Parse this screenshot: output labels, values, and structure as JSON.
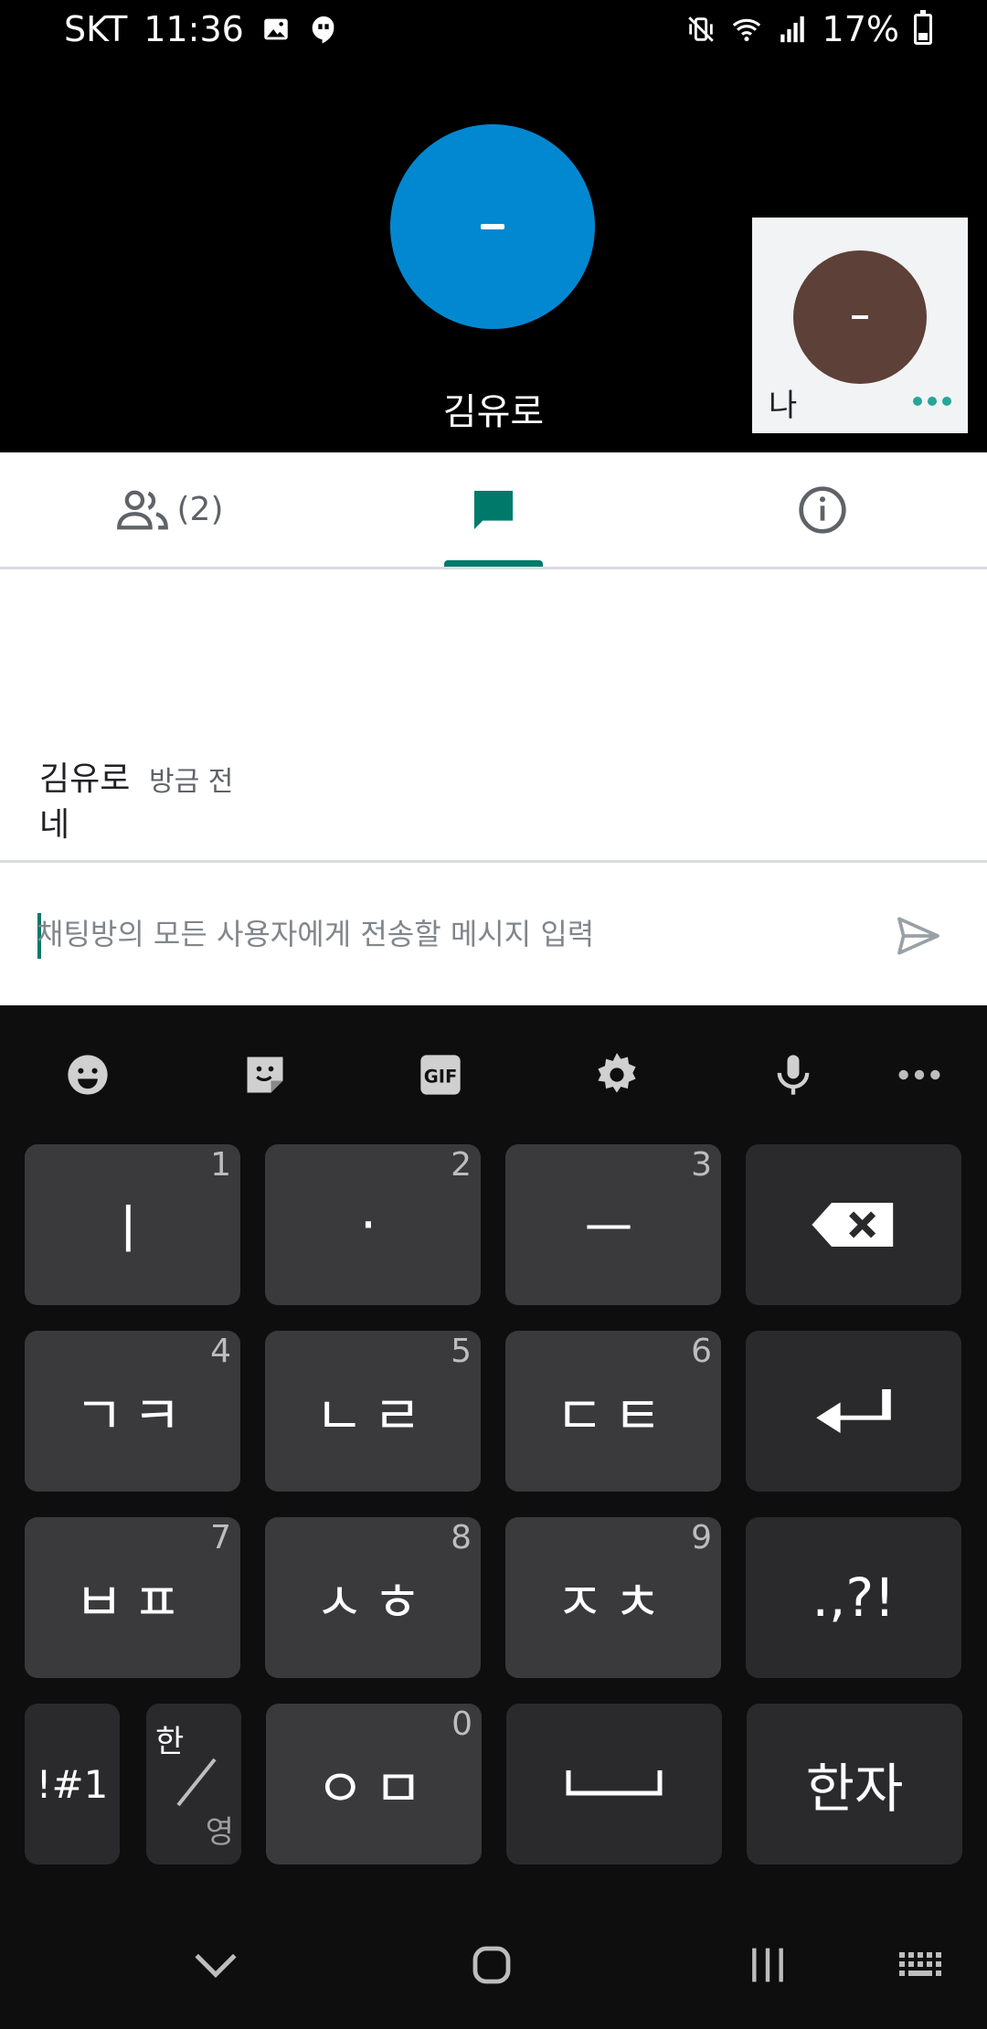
{
  "status_bar": {
    "carrier": "SKT",
    "time": "11:36",
    "battery": "17%",
    "left_icons": [
      "image-icon",
      "hangouts-icon"
    ],
    "right_icons": [
      "vibrate-mute-icon",
      "wifi-icon",
      "signal-icon",
      "battery-icon"
    ]
  },
  "call": {
    "remote_avatar_initial": "-",
    "remote_name": "김유로",
    "remote_avatar_color": "#0288d1",
    "self_avatar_initial": "-",
    "self_label": "나",
    "self_avatar_color": "#5d4037"
  },
  "tabs": {
    "people_count": "(2)",
    "active": "chat",
    "accent_color": "#00796b"
  },
  "messages": [
    {
      "sender": "김유로",
      "time": "방금 전",
      "text": "네"
    }
  ],
  "composer": {
    "placeholder": "채팅방의 모든 사용자에게 전송할 메시지 입력",
    "value": ""
  },
  "keyboard": {
    "toolbar": [
      "emoji-icon",
      "sticker-icon",
      "gif-icon",
      "settings-icon",
      "mic-icon",
      "more-icon"
    ],
    "gif_label": "GIF",
    "rows": [
      [
        {
          "label": "ㅣ",
          "num": "1"
        },
        {
          "label": "·",
          "num": "2"
        },
        {
          "label": "ㅡ",
          "num": "3"
        },
        {
          "label": "⌫",
          "num": ""
        }
      ],
      [
        {
          "label": "ㄱㅋ",
          "num": "4"
        },
        {
          "label": "ㄴㄹ",
          "num": "5"
        },
        {
          "label": "ㄷㅌ",
          "num": "6"
        },
        {
          "label": "↵",
          "num": ""
        }
      ],
      [
        {
          "label": "ㅂㅍ",
          "num": "7"
        },
        {
          "label": "ㅅㅎ",
          "num": "8"
        },
        {
          "label": "ㅈㅊ",
          "num": "9"
        },
        {
          "label": ".,?!",
          "num": ""
        }
      ],
      [
        {
          "label": "!#1",
          "num": ""
        },
        {
          "label": "한/영",
          "num": ""
        },
        {
          "label": "ㅇㅁ",
          "num": "0"
        },
        {
          "label": "␣",
          "num": ""
        },
        {
          "label": "한자",
          "num": ""
        }
      ]
    ],
    "han_label": "한",
    "yeong_label": "영"
  },
  "nav_bar": [
    "back-icon",
    "home-icon",
    "recents-icon",
    "keyboard-switch-icon"
  ]
}
